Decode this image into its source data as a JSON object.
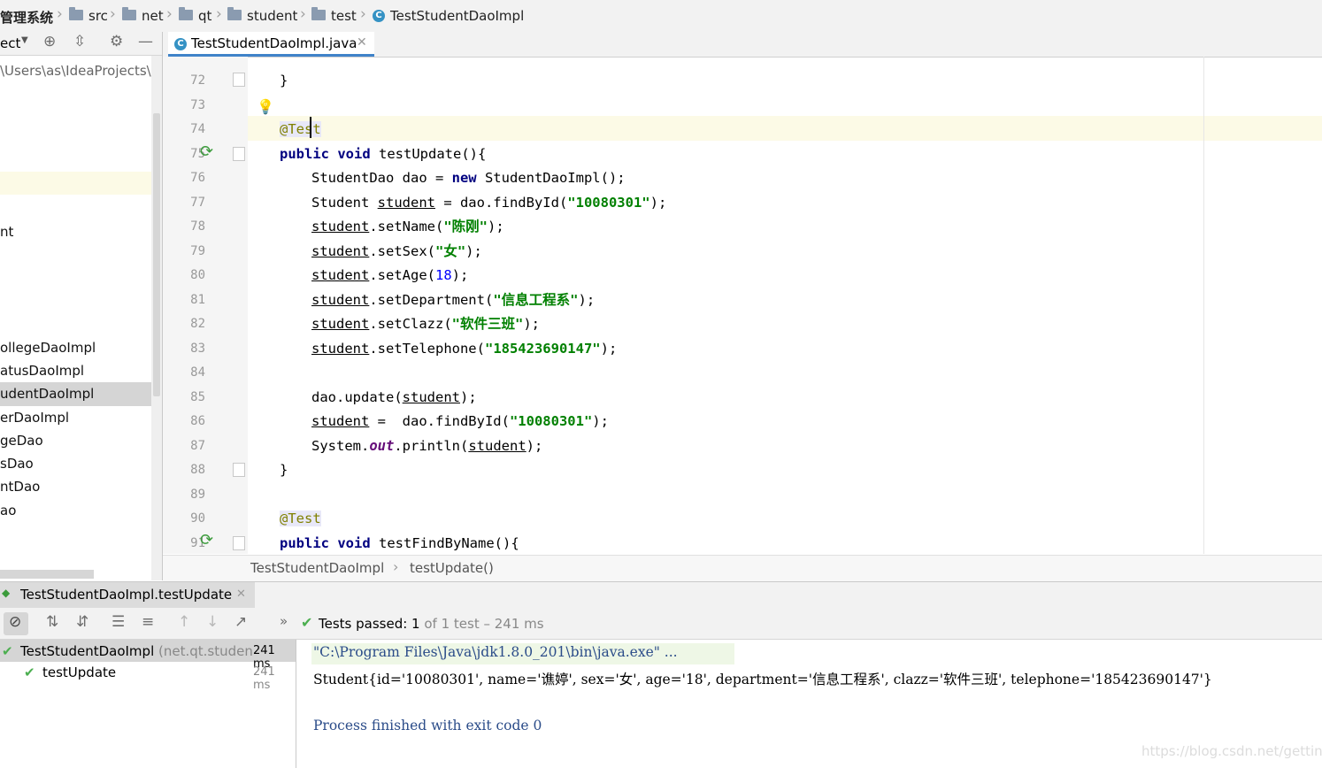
{
  "navbar": {
    "crumbs": [
      "管理系统",
      "src",
      "net",
      "qt",
      "student",
      "test",
      "TestStudentDaoImpl"
    ]
  },
  "project": {
    "dropdown_label": "ect",
    "path": "\\Users\\as\\IdeaProjects\\学",
    "items": [
      "nt",
      "ollegeDaoImpl",
      "atusDaoImpl",
      "udentDaoImpl",
      "erDaoImpl",
      "geDao",
      "sDao",
      "ntDao",
      "ao"
    ],
    "selected_index": 3
  },
  "editor": {
    "tab_label": "TestStudentDaoImpl.java",
    "line_numbers": [
      "72",
      "73",
      "74",
      "75",
      "76",
      "77",
      "78",
      "79",
      "80",
      "81",
      "82",
      "83",
      "84",
      "85",
      "86",
      "87",
      "88",
      "89",
      "90",
      "91"
    ],
    "crumb_class": "TestStudentDaoImpl",
    "crumb_method": "testUpdate()"
  },
  "code": {
    "l72": "}",
    "l74": "@Test",
    "l75_kw1": "public",
    "l75_kw2": "void",
    "l75_rest": "testUpdate(){",
    "l76_a": "StudentDao dao = ",
    "l76_kw": "new",
    "l76_b": " StudentDaoImpl();",
    "l77_a": "Student ",
    "l77_var": "student",
    "l77_b": " = dao.findById(",
    "l77_str": "\"10080301\"",
    "l77_c": ");",
    "l78_var": "student",
    "l78_a": ".setName(",
    "l78_str": "\"陈刚\"",
    "l78_b": ");",
    "l79_var": "student",
    "l79_a": ".setSex(",
    "l79_str": "\"女\"",
    "l79_b": ");",
    "l80_var": "student",
    "l80_a": ".setAge(",
    "l80_num": "18",
    "l80_b": ");",
    "l81_var": "student",
    "l81_a": ".setDepartment(",
    "l81_str": "\"信息工程系\"",
    "l81_b": ");",
    "l82_var": "student",
    "l82_a": ".setClazz(",
    "l82_str": "\"软件三班\"",
    "l82_b": ");",
    "l83_var": "student",
    "l83_a": ".setTelephone(",
    "l83_str": "\"185423690147\"",
    "l83_b": ");",
    "l85_a": "dao.update(",
    "l85_var": "student",
    "l85_b": ");",
    "l86_var": "student",
    "l86_a": " =  dao.findById(",
    "l86_str": "\"10080301\"",
    "l86_b": ");",
    "l87_a": "System.",
    "l87_field": "out",
    "l87_b": ".println(",
    "l87_var": "student",
    "l87_c": ");",
    "l88": "}",
    "l90": "@Test",
    "l91_kw1": "public",
    "l91_kw2": "void",
    "l91_rest": "testFindByName(){"
  },
  "run": {
    "tab_label": "TestStudentDaoImpl.testUpdate",
    "status_bold": "Tests passed: ",
    "status_count": "1",
    "status_rest": " of 1 test – 241 ms",
    "tree": [
      {
        "name": "TestStudentDaoImpl",
        "pkg": "(net.qt.studen",
        "time": "241 ms"
      },
      {
        "name": "testUpdate",
        "pkg": "",
        "time": "241 ms"
      }
    ]
  },
  "console": {
    "cmd": "\"C:\\Program Files\\Java\\jdk1.8.0_201\\bin\\java.exe\" ...",
    "output": "Student{id='10080301', name='谯婷', sex='女', age='18', department='信息工程系', clazz='软件三班', telephone='185423690147'}",
    "exit": "Process finished with exit code 0",
    "watermark": "https://blog.csdn.net/gettingi"
  },
  "colors": {
    "keyword": "#000080",
    "string": "#008000",
    "number": "#0000ff",
    "annotation": "#808000",
    "pass_green": "#4caf50",
    "accent_blue": "#4083c9"
  }
}
